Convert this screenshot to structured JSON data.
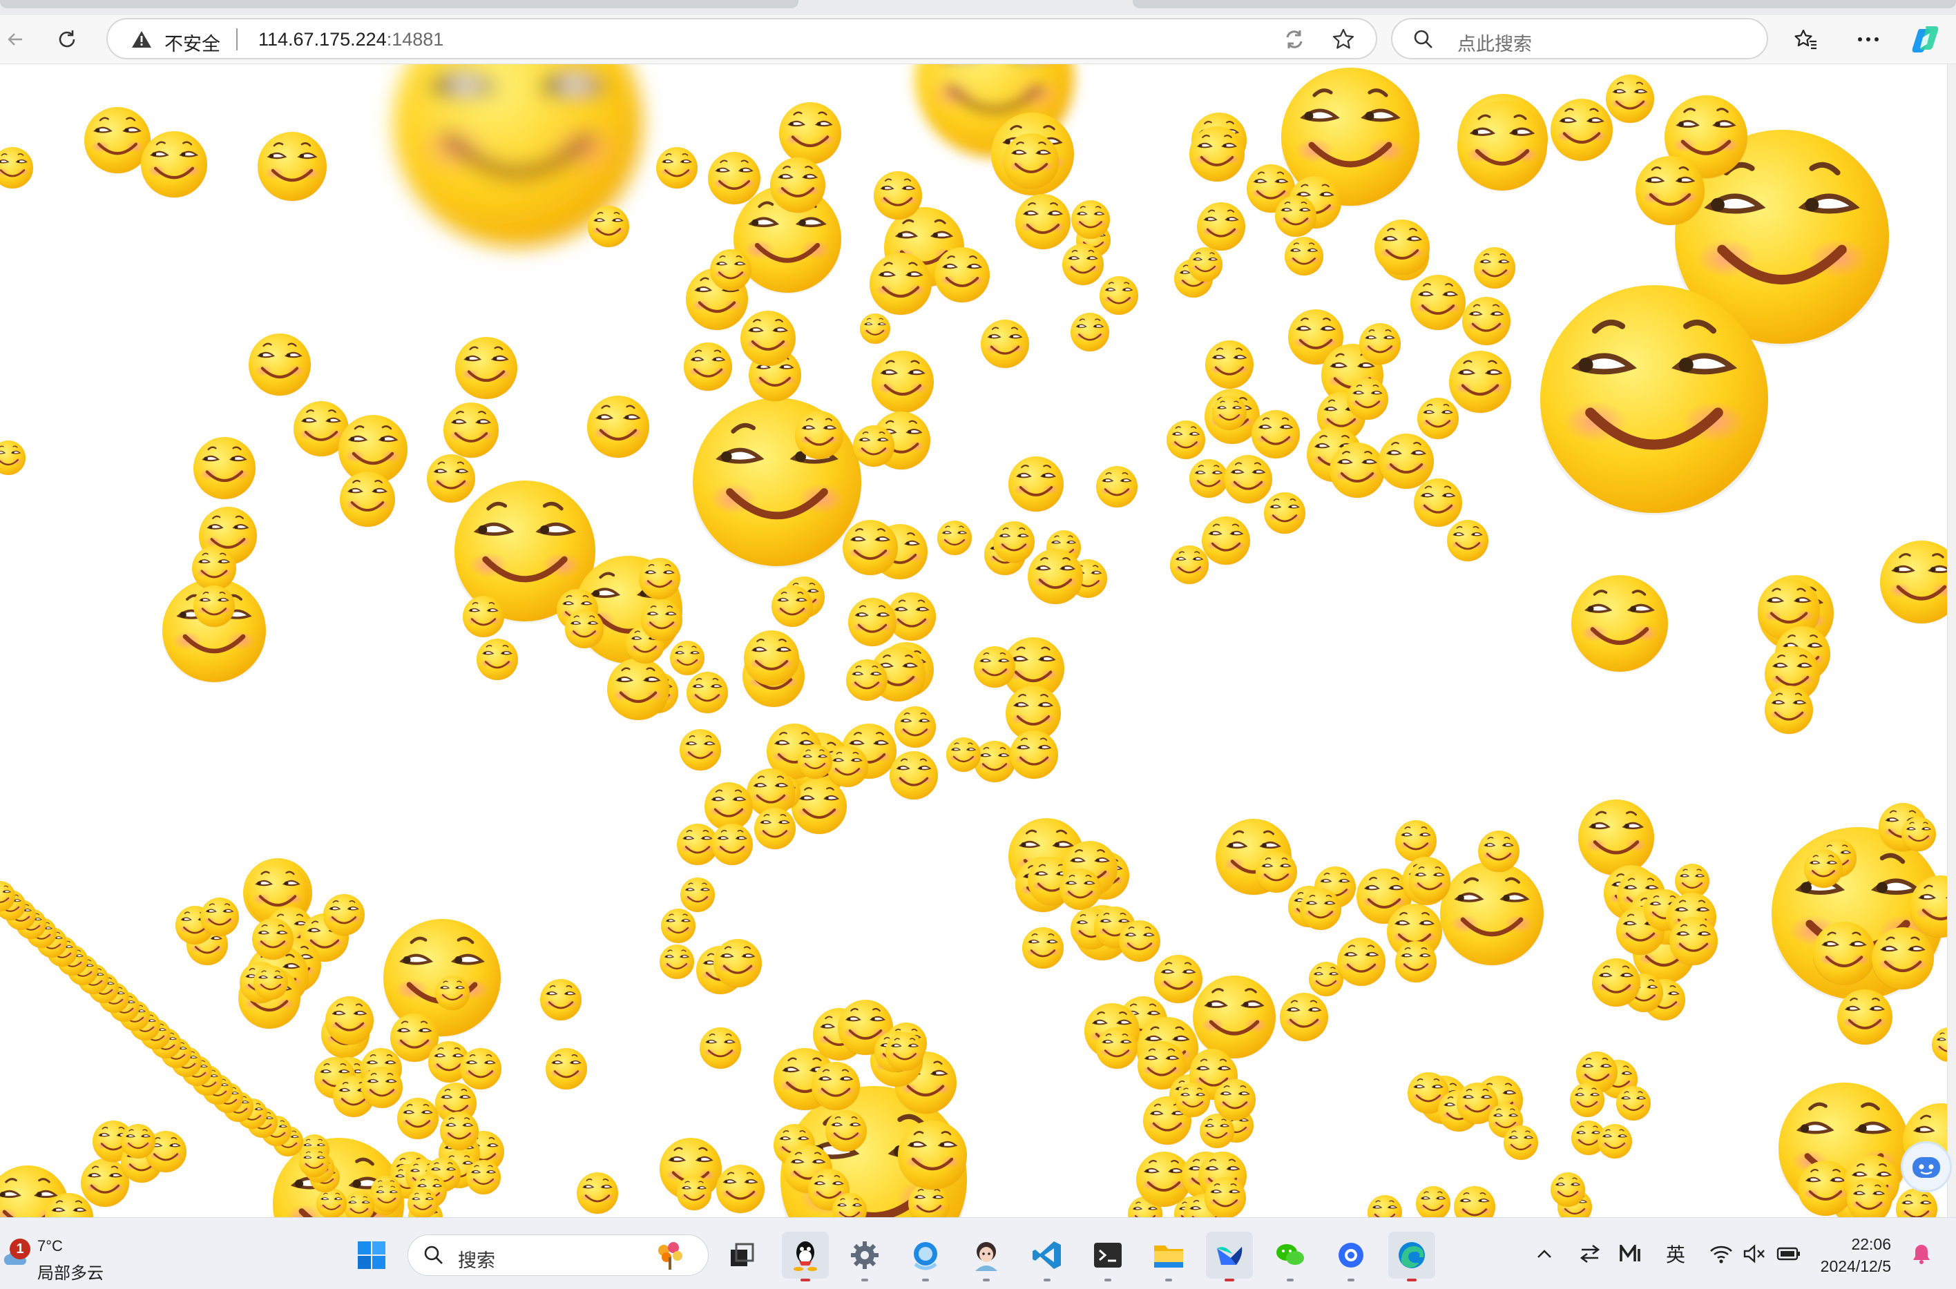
{
  "browser": {
    "security_label": "不安全",
    "url_host": "114.67.175.224",
    "url_port": ":14881",
    "search_placeholder": "点此搜索"
  },
  "page": {
    "background": "#ffffff",
    "emoji_colors": {
      "face_light": "#fff27a",
      "face_mid": "#ffd21f",
      "face_dark": "#f0a500",
      "mouth": "#a0522d",
      "blush": "#ff9a8a"
    }
  },
  "taskbar": {
    "weather": {
      "alert_count": "1",
      "temperature": "7°C",
      "condition": "局部多云"
    },
    "search_label": "搜索",
    "apps": [
      "task-view-icon",
      "qq-icon",
      "settings-icon",
      "copilot-chat-icon",
      "avatar-app-icon",
      "vscode-icon",
      "terminal-icon",
      "file-explorer-icon",
      "feishu-icon",
      "wechat-icon",
      "browser-app-icon",
      "edge-icon"
    ],
    "tray": {
      "language": "英"
    },
    "clock": {
      "time": "22:06",
      "date": "2024/12/5"
    }
  }
}
